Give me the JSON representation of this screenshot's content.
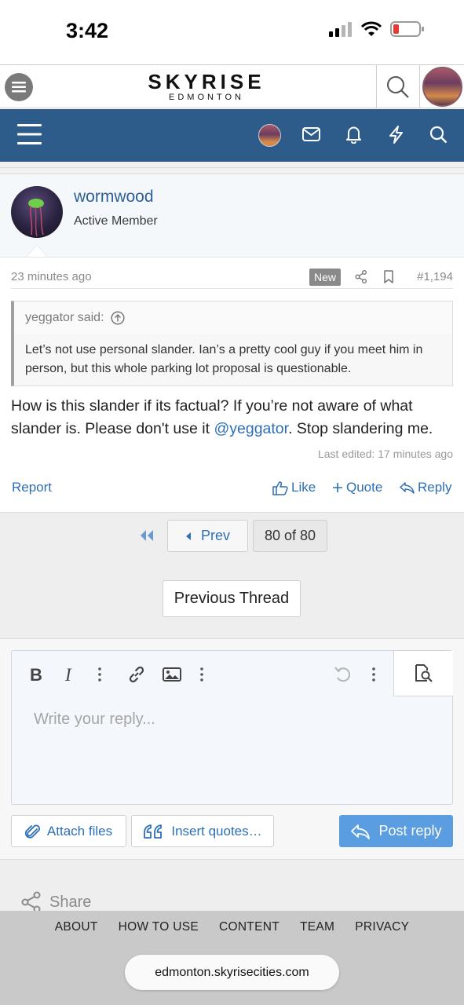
{
  "status_bar": {
    "time": "3:42"
  },
  "site_header": {
    "logo_main": "SKYRISE",
    "logo_sub": "EDMONTON"
  },
  "post": {
    "username": "wormwood",
    "user_title": "Active Member",
    "date": "23 minutes ago",
    "badge": "New",
    "number": "#1,194",
    "quote": {
      "author": "yeggator said:",
      "text": "Let’s not use personal slander. Ian’s a pretty cool guy if you meet him in person, but this whole parking lot proposal is questionable."
    },
    "body_before": "How is this slander if its factual? If you’re not aware of what slander is. Please don't use it ",
    "mention": "@yeggator",
    "body_after": ". Stop slandering me.",
    "last_edited": "Last edited: 17 minutes ago",
    "actions": {
      "report": "Report",
      "like": "Like",
      "quote": "Quote",
      "reply": "Reply"
    }
  },
  "pagination": {
    "prev": "Prev",
    "page_of": "80 of 80",
    "previous_thread": "Previous Thread"
  },
  "editor": {
    "placeholder": "Write your reply...",
    "attach_files": "Attach files",
    "insert_quotes": "Insert quotes…",
    "post_reply": "Post reply"
  },
  "share": {
    "label": "Share"
  },
  "footer": {
    "links": [
      "ABOUT",
      "HOW TO USE",
      "CONTENT",
      "TEAM",
      "PRIVACY"
    ],
    "url": "edmonton.skyrisecities.com"
  },
  "colors": {
    "nav_blue": "#2d5b8a",
    "link_blue": "#2d6fb5",
    "post_button": "#5a9de0"
  }
}
